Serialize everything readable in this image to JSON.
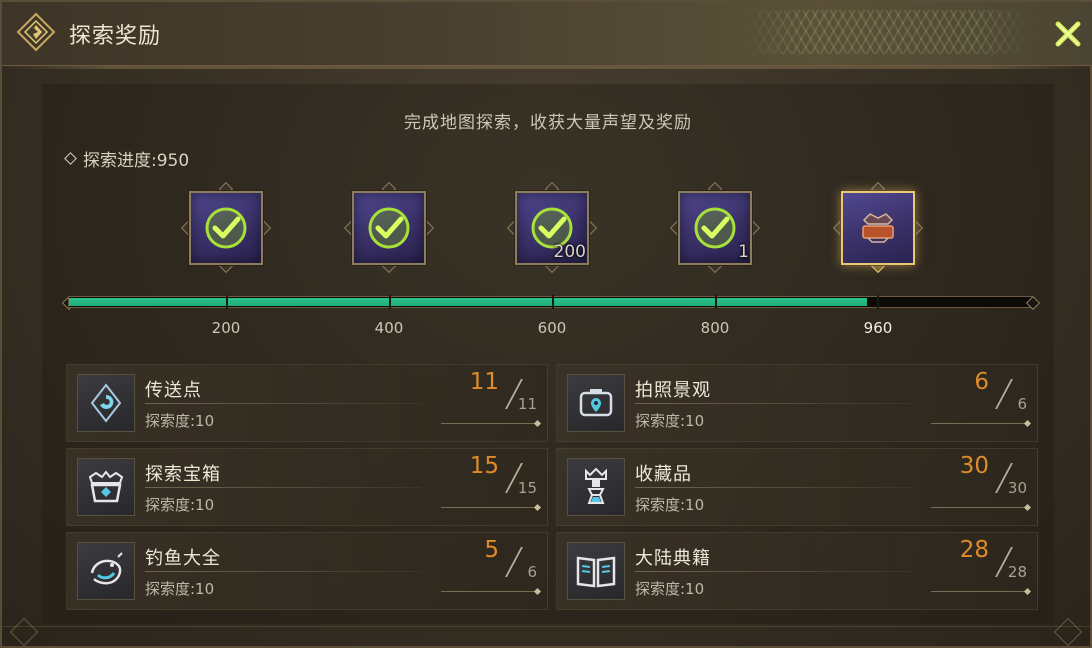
{
  "window": {
    "title": "探索奖励",
    "close_icon": "close-x-icon",
    "accent_color": "#c8e04a"
  },
  "header": {
    "subtitle": "完成地图探索，收获大量声望及奖励",
    "progress_label": "探索进度:950"
  },
  "progress": {
    "current": 950,
    "max": 960,
    "fill_color": "#1fae7a",
    "milestones": [
      {
        "value": "200",
        "reward_icon": "reward-item-icon",
        "claimed": true,
        "quantity": ""
      },
      {
        "value": "400",
        "reward_icon": "reward-item-icon",
        "claimed": true,
        "quantity": ""
      },
      {
        "value": "600",
        "reward_icon": "reward-item-icon",
        "claimed": true,
        "quantity": "200"
      },
      {
        "value": "800",
        "reward_icon": "reward-item-icon",
        "claimed": true,
        "quantity": "1"
      },
      {
        "value": "960",
        "reward_icon": "title-badge-icon",
        "claimed": false,
        "quantity": ""
      }
    ]
  },
  "stats": [
    {
      "name": "传送点",
      "desc": "探索度:10",
      "current": "11",
      "total": "11",
      "icon": "teleport-icon"
    },
    {
      "name": "拍照景观",
      "desc": "探索度:10",
      "current": "6",
      "total": "6",
      "icon": "photo-spot-icon"
    },
    {
      "name": "探索宝箱",
      "desc": "探索度:10",
      "current": "15",
      "total": "15",
      "icon": "treasure-chest-icon"
    },
    {
      "name": "收藏品",
      "desc": "探索度:10",
      "current": "30",
      "total": "30",
      "icon": "collectible-icon"
    },
    {
      "name": "钓鱼大全",
      "desc": "探索度:10",
      "current": "5",
      "total": "6",
      "icon": "fishing-icon"
    },
    {
      "name": "大陆典籍",
      "desc": "探索度:10",
      "current": "28",
      "total": "28",
      "icon": "book-icon"
    }
  ]
}
